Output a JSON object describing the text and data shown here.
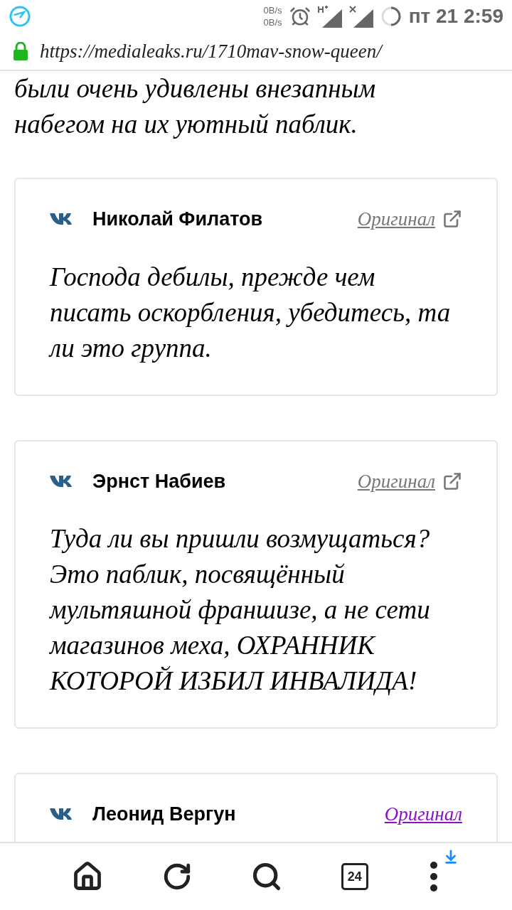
{
  "status_bar": {
    "net_up": "0B/s",
    "net_down": "0B/s",
    "clock": "пт 21 2:59"
  },
  "address_bar": {
    "url": "https://medialeaks.ru/1710mav-snow-queen/",
    "secure": true
  },
  "article": {
    "cut_line": "были очень удивлены внезапным",
    "paragraph_end": "набегом на их уютный паблик."
  },
  "posts": [
    {
      "author": "Николай Филатов",
      "link": "Оригинал",
      "visited": false,
      "text": "Господа дебилы, прежде чем писать оскорбления, убедитесь, та ли это группа."
    },
    {
      "author": "Эрнст Набиев",
      "link": "Оригинал",
      "visited": false,
      "text": "Туда ли вы пришли возмущаться? Это паблик, посвящённый мультяшной франшизе, а не сети магазинов меха, ОХРАННИК КОТОРОЙ ИЗБИЛ ИНВАЛИДА!"
    },
    {
      "author": "Леонид Вергун",
      "link": "Оригинал",
      "visited": true
    }
  ],
  "toolbar": {
    "tab_count": "24",
    "download_badge": true
  }
}
